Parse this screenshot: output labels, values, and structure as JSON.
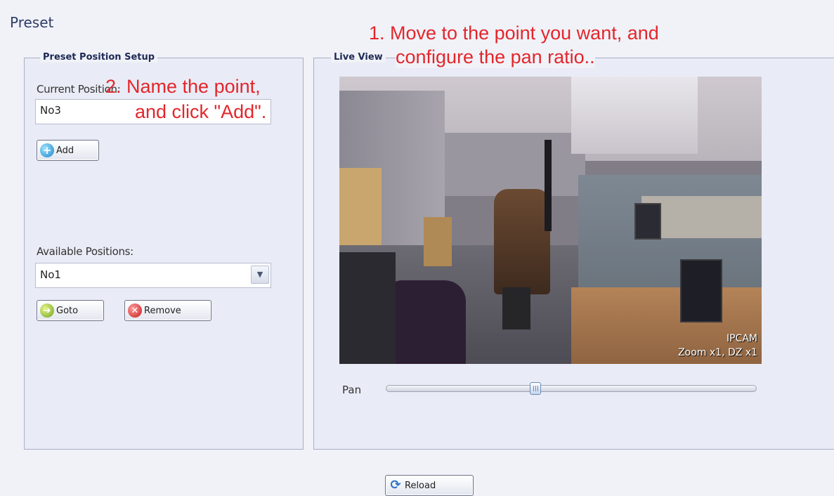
{
  "page": {
    "title": "Preset"
  },
  "setup": {
    "legend": "Preset Position Setup",
    "current_label": "Current Position:",
    "current_value": "No3",
    "add_label": "Add",
    "available_label": "Available Positions:",
    "available_selected": "No1",
    "goto_label": "Goto",
    "remove_label": "Remove"
  },
  "live": {
    "legend": "Live View",
    "overlay_line1": "IPCAM",
    "overlay_line2": "Zoom x1, DZ x1",
    "pan_label": "Pan",
    "pan_value_fraction": 0.4
  },
  "footer": {
    "reload_label": "Reload"
  },
  "annotations": {
    "step1_line1": "1. Move to the point you want, and",
    "step1_line2": "configure the pan ratio..",
    "step2_line1": "2. Name the point,",
    "step2_line2": "and click \"Add\"."
  },
  "icons": {
    "add": "plus-circle-icon",
    "goto": "arrow-right-circle-icon",
    "remove": "x-circle-icon",
    "reload": "refresh-icon",
    "dropdown": "chevron-down-icon"
  },
  "colors": {
    "annotation": "#e3262b",
    "title": "#2f3c66",
    "legend": "#1e2a55"
  }
}
